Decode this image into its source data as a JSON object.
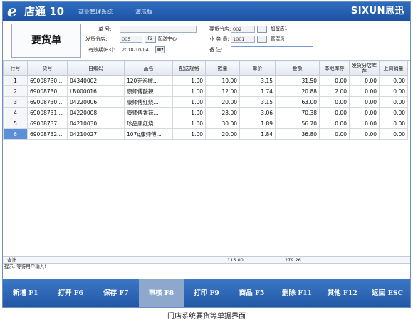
{
  "titlebar": {
    "logo_letter": "e",
    "app_name": "店通 10",
    "system_name": "商业管理系统",
    "edition": "演示版",
    "brand": "SIXUN思迅"
  },
  "form": {
    "title": "要货单",
    "doc_no_label": "单   号:",
    "doc_no_value": "",
    "ship_branch_label": "发货分店:",
    "ship_branch_code": "005",
    "ship_branch_button": "F2",
    "ship_branch_name": "配送中心",
    "valid_label": "有效期(F3):",
    "valid_value": "2018-10-04",
    "request_branch_label": "要货分店:",
    "request_branch_code": "002",
    "request_branch_button": "···",
    "request_branch_name": "加盟店1",
    "clerk_label": "业 务 员:",
    "clerk_code": "1001",
    "clerk_button": "···",
    "clerk_name": "管理员",
    "remark_label": "备   注:",
    "remark_value": ""
  },
  "table": {
    "columns": [
      "行号",
      "货号",
      "自编码",
      "品名",
      "配送规格",
      "数量",
      "单价",
      "金额",
      "本地库存",
      "发货分店库存",
      "上周销量"
    ],
    "rows": [
      [
        "1",
        "69008730...",
        "04340002",
        "120克泡椒...",
        "1.00",
        "10.00",
        "3.15",
        "31.50",
        "0.00",
        "0.00",
        "0.00"
      ],
      [
        "2",
        "69008730...",
        "LB000016",
        "康师傅酸辣...",
        "1.00",
        "12.00",
        "1.74",
        "20.88",
        "2.00",
        "0.00",
        "0.00"
      ],
      [
        "3",
        "69008730...",
        "04220006",
        "康师傅红烧...",
        "1.00",
        "20.00",
        "3.15",
        "63.00",
        "0.00",
        "0.00",
        "0.00"
      ],
      [
        "4",
        "69008731...",
        "04220008",
        "康师傅香辣...",
        "1.00",
        "23.00",
        "3.06",
        "70.38",
        "0.00",
        "0.00",
        "0.00"
      ],
      [
        "5",
        "69008737...",
        "04210030",
        "珍品康红烧...",
        "1.00",
        "30.00",
        "1.89",
        "56.70",
        "0.00",
        "0.00",
        "0.00"
      ],
      [
        "6",
        "69008732...",
        "04210027",
        "107g康师傅...",
        "1.00",
        "20.00",
        "1.84",
        "36.80",
        "0.00",
        "0.00",
        "0.00"
      ]
    ],
    "selected_row": 6
  },
  "totals": {
    "label": "合计",
    "quantity": "115.00",
    "amount": "279.26"
  },
  "status_text": "提示: 等待用户输入!",
  "actions": [
    {
      "label": "新增 F1"
    },
    {
      "label": "打开 F6"
    },
    {
      "label": "保存 F7"
    },
    {
      "label": "审核 F8"
    },
    {
      "label": "打印 F9"
    },
    {
      "label": "商品 F5"
    },
    {
      "label": "删除 F11"
    },
    {
      "label": "其他 F12"
    },
    {
      "label": "返回 ESC"
    }
  ],
  "active_action": "审核 F8",
  "caption": "门店系统要货等单据界面",
  "colors": {
    "titlebar": "#1d53a3",
    "actionbar": "#2257a5",
    "selected_row": "#5b8fd6",
    "active_action": "#8da8cc"
  }
}
